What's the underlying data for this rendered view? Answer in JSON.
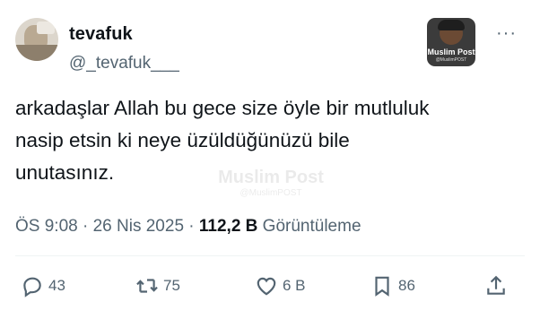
{
  "author": {
    "display_name": "tevafuk",
    "handle": "@_tevafuk___"
  },
  "badge": {
    "name": "Muslim Post",
    "sub": "@MuslimPOST"
  },
  "watermark": {
    "name": "Muslim Post",
    "sub": "@MuslimPOST"
  },
  "more_label": "···",
  "tweet": {
    "lines": [
      "arkadaşlar Allah bu gece size öyle bir mutluluk",
      "nasip etsin ki neye üzüldüğünüzü bile",
      "unutasınız."
    ]
  },
  "meta": {
    "time": "ÖS 9:08",
    "sep1": " · ",
    "date": "26 Nis 2025",
    "sep2": " · ",
    "views": "112,2 B",
    "views_label": " Görüntüleme"
  },
  "actions": {
    "reply_count": "43",
    "retweet_count": "75",
    "like_count": "6 B",
    "bookmark_count": "86"
  },
  "icons": {
    "reply": "reply-icon",
    "retweet": "retweet-icon",
    "like": "heart-icon",
    "bookmark": "bookmark-icon",
    "share": "share-icon"
  }
}
